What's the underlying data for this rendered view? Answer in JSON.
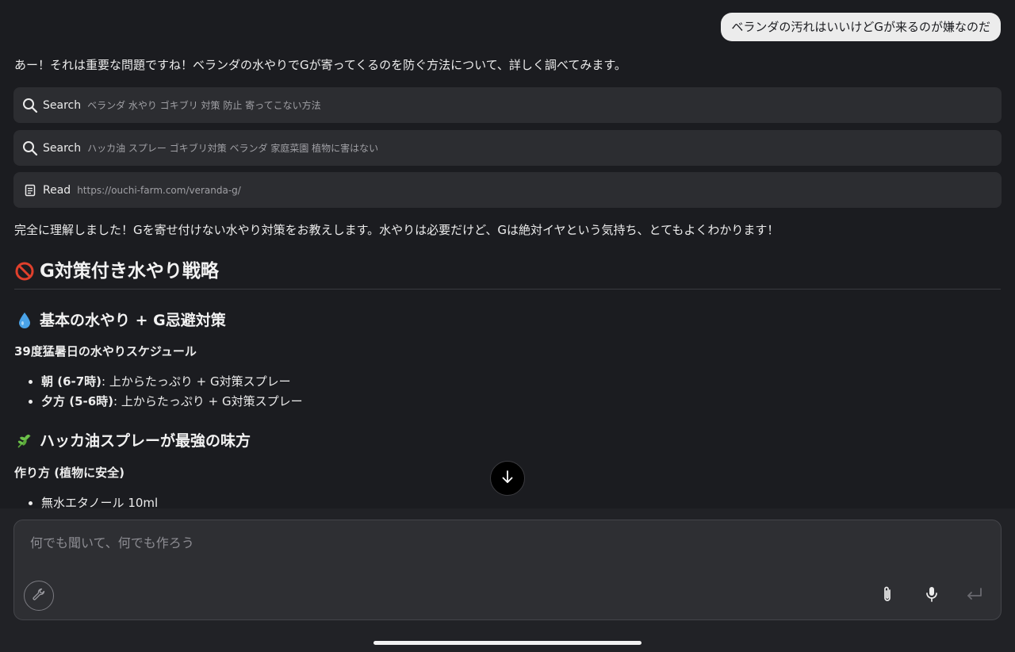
{
  "user_message": "ベランダの汚れはいいけどGが来るのが嫌なのだ",
  "assistant": {
    "intro": "あー！それは重要な問題ですね！ベランダの水やりでGが寄ってくるのを防ぐ方法について、詳しく調べてみます。",
    "tools": [
      {
        "verb": "Search",
        "query": "ベランダ 水やり ゴキブリ 対策 防止 寄ってこない方法",
        "icon": "search-icon"
      },
      {
        "verb": "Search",
        "query": "ハッカ油 スプレー ゴキブリ対策 ベランダ 家庭菜園 植物に害はない",
        "icon": "search-icon"
      },
      {
        "verb": "Read",
        "query": "https://ouchi-farm.com/veranda-g/",
        "icon": "document-icon"
      }
    ],
    "summary": "完全に理解しました！Gを寄せ付けない水やり対策をお教えします。水やりは必要だけど、Gは絶対イヤという気持ち、とてもよくわかります！",
    "heading1": "G対策付き水やり戦略",
    "section1": {
      "heading": "基本の水やり + G忌避対策",
      "subheading": "39度猛暑日の水やりスケジュール",
      "items": [
        {
          "label": "朝 (6-7時)",
          "text": ": 上からたっぷり + G対策スプレー"
        },
        {
          "label": "夕方 (5-6時)",
          "text": ": 上からたっぷり + G対策スプレー"
        }
      ]
    },
    "section2": {
      "heading": "ハッカ油スプレーが最強の味方",
      "subheading": "作り方 (植物に安全)",
      "items": [
        {
          "text": "無水エタノール 10ml"
        }
      ]
    }
  },
  "composer": {
    "placeholder": "何でも聞いて、何でも作ろう"
  },
  "colors": {
    "background": "#1b1c20",
    "tool_card": "#2c2d31",
    "user_bubble": "#ececec"
  }
}
